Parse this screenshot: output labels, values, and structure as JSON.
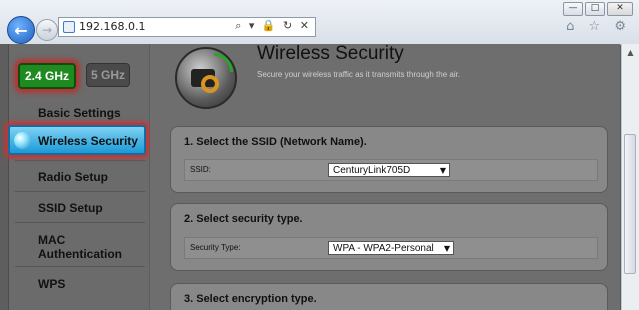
{
  "browser": {
    "url": "192.168.0.1",
    "address_tools": "⌕ ▾ 🔒 ↻ ✕",
    "right_icons": "⌂ ☆ ⚙",
    "window_buttons": [
      "—",
      "□",
      "✕"
    ],
    "back_glyph": "←",
    "forward_glyph": "→"
  },
  "sidebar": {
    "bands": [
      {
        "label": "2.4 GHz",
        "active": true
      },
      {
        "label": "5 GHz",
        "active": false
      }
    ],
    "items": [
      {
        "label": "Basic Settings"
      },
      {
        "label": "Wireless Security",
        "active": true
      },
      {
        "label": "Radio Setup"
      },
      {
        "label": "SSID Setup"
      },
      {
        "label": "MAC Authentication"
      },
      {
        "label": "WPS"
      }
    ]
  },
  "page": {
    "title": "Wireless Security",
    "subtitle": "Secure your wireless traffic as it transmits through the air."
  },
  "sections": [
    {
      "heading": "1. Select the SSID (Network Name).",
      "field_label": "SSID:",
      "value": "CenturyLink705D"
    },
    {
      "heading": "2. Select security type.",
      "field_label": "Security Type:",
      "value": "WPA - WPA2-Personal"
    },
    {
      "heading": "3. Select encryption type."
    }
  ],
  "colors": {
    "band_active": "#1f8a1f",
    "nav_active": "#1a9ad8",
    "highlight_glow": "#d32f2f"
  }
}
